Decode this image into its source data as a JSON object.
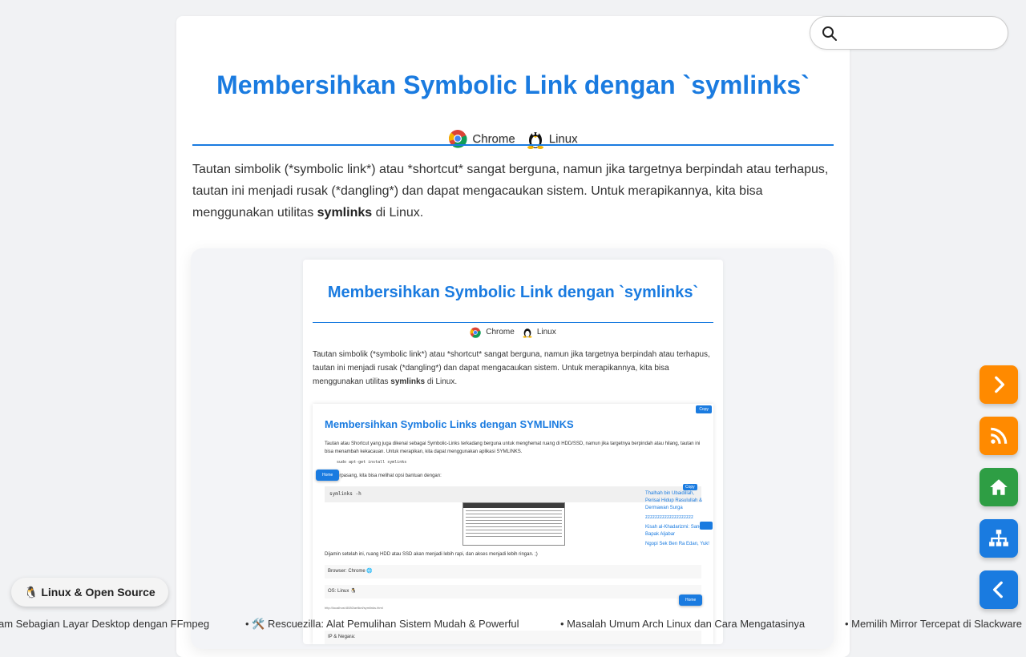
{
  "article": {
    "title": "Membersihkan Symbolic Link dengan `symlinks`",
    "browsers": [
      {
        "icon": "chrome-icon",
        "label": "Chrome"
      },
      {
        "icon": "linux-icon",
        "label": "Linux"
      }
    ],
    "intro_before": "Tautan simbolik (*symbolic link*) atau *shortcut* sangat berguna, namun jika targetnya berpindah atau terhapus, tautan ini menjadi rusak (*dangling*) dan dapat mengacaukan sistem. Untuk merapikannya, kita bisa menggunakan utilitas ",
    "intro_bold": "symlinks",
    "intro_after": " di Linux."
  },
  "preview": {
    "title": "Membersihkan Symbolic Link dengan `symlinks`",
    "browsers": [
      "Chrome",
      "Linux"
    ],
    "intro_before": "Tautan simbolik (*symbolic link*) atau *shortcut* sangat berguna, namun jika targetnya berpindah atau terhapus, tautan ini menjadi rusak (*dangling*) dan dapat mengacaukan sistem. Untuk merapikannya, kita bisa menggunakan utilitas ",
    "intro_bold": "symlinks",
    "intro_after": " di Linux.",
    "inner": {
      "copy_label": "Copy",
      "title": "Membersihkan Symbolic Links dengan SYMLINKS",
      "p1": "Tautan atau Shortcut yang juga dikenal sebagai Symbolic-Links terkadang berguna untuk menghemat ruang di HDD/SSD, namun jika targetnya berpindah atau hilang, tautan ini bisa menambah kekacauan. Untuk merapikan, kita dapat menggunakan aplikasi SYMLINKS.",
      "cmd1": "sudo apt-get install symlinks",
      "p2": "...erpasang, kita bisa melihat opsi bantuan dengan:",
      "home_label": "Home",
      "code": "symlinks -h",
      "side_links": [
        "Thalhah bin Ubaidillah, Perisai Hidup Rasulullah & Dermawan Surga",
        "zzzzzzzzzzzzzzzzzzzz",
        "Kisah al-Khadarizmi: Sang Bapak Aljabar",
        "Ngopi Sek Ben Ra Edan, Yuk!"
      ],
      "p3": "Dijamin setelah ini, ruang HDD atau SSD akan menjadi lebih rapi, dan akses menjadi lebih ringan. ;)",
      "browser_line": "Browser: Chrome 🌐",
      "os_line": "OS: Linux 🐧",
      "url": "http://localhost:8080/artikel/symlinks.html",
      "ip_line": "IP & Negara:"
    }
  },
  "search": {
    "placeholder": "",
    "value": ""
  },
  "fabs": [
    {
      "name": "next-button",
      "icon": "chevron-right-icon",
      "color": "#ff8a00"
    },
    {
      "name": "rss-button",
      "icon": "rss-icon",
      "color": "#ff8a00"
    },
    {
      "name": "home-button",
      "icon": "home-icon",
      "color": "#2e9e44"
    },
    {
      "name": "sitemap-button",
      "icon": "sitemap-icon",
      "color": "#1a7be0"
    },
    {
      "name": "back-button",
      "icon": "chevron-left-icon",
      "color": "#1a7be0"
    }
  ],
  "category_tag": "🐧 Linux & Open Source",
  "ticker": [
    "am Sebagian Layar Desktop dengan FFmpeg",
    "• 🛠️ Rescuezilla: Alat Pemulihan Sistem Mudah & Powerful",
    "• Masalah Umum Arch Linux dan Cara Mengatasinya",
    "• Memilih Mirror Tercepat di Slackware"
  ]
}
